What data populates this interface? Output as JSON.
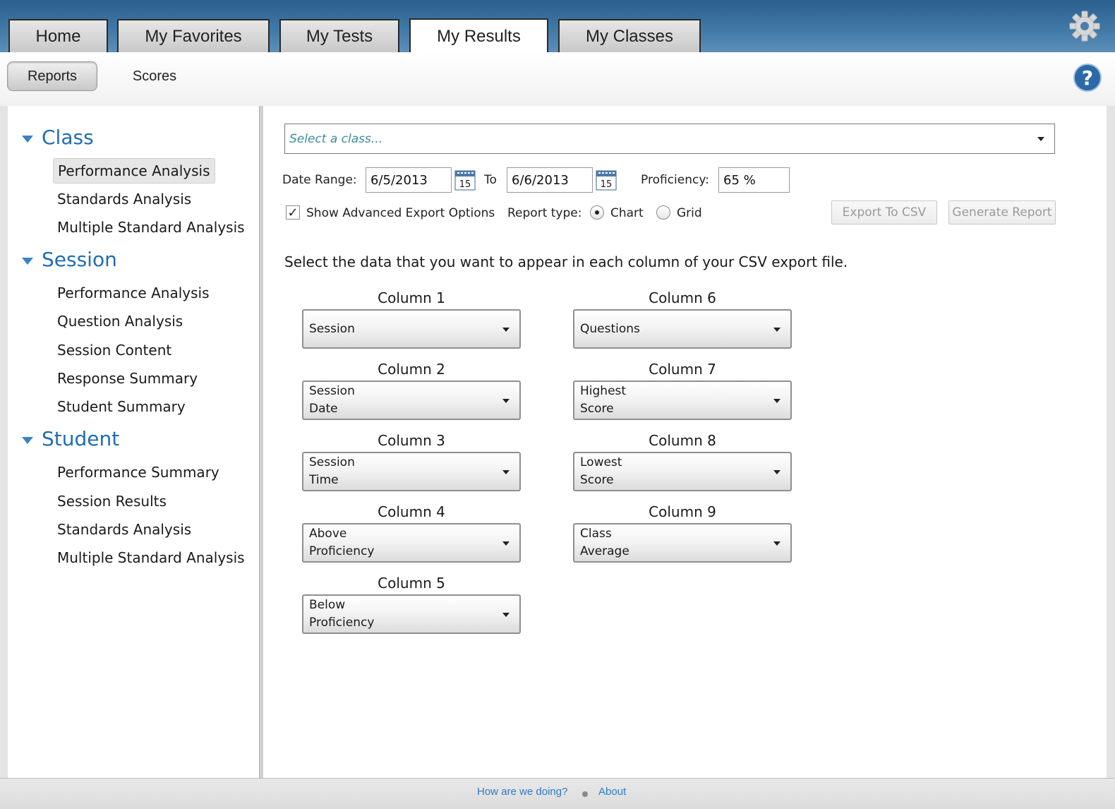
{
  "tabs": [
    {
      "label": "Home"
    },
    {
      "label": "My Favorites"
    },
    {
      "label": "My Tests"
    },
    {
      "label": "My Results"
    },
    {
      "label": "My Classes"
    }
  ],
  "active_tab": "My Results",
  "subnav": {
    "reports": "Reports",
    "scores": "Scores",
    "help": "?"
  },
  "sidebar": {
    "sections": [
      {
        "title": "Class",
        "items": [
          "Performance Analysis",
          "Standards Analysis",
          "Multiple Standard Analysis"
        ]
      },
      {
        "title": "Session",
        "items": [
          "Performance Analysis",
          "Question Analysis",
          "Session Content",
          "Response Summary",
          "Student Summary"
        ]
      },
      {
        "title": "Student",
        "items": [
          "Performance Summary",
          "Session Results",
          "Standards Analysis",
          "Multiple Standard Analysis"
        ]
      }
    ],
    "selected": "Class / Performance Analysis"
  },
  "main": {
    "class_select_placeholder": "Select a class...",
    "date_range_label": "Date Range:",
    "date_from": "6/5/2013",
    "to_label": "To",
    "date_to": "6/6/2013",
    "calendar_day": "15",
    "proficiency_label": "Proficiency:",
    "proficiency_value": "65 %",
    "advanced_export_label": "Show Advanced Export Options",
    "advanced_export_checked": true,
    "report_type_label": "Report type:",
    "report_type_chart": "Chart",
    "report_type_grid": "Grid",
    "report_type_selected": "Chart",
    "export_csv_label": "Export To CSV",
    "generate_report_label": "Generate Report",
    "instructions": "Select the data that you want to appear in each column of your CSV export file.",
    "columns": [
      {
        "title": "Column 1",
        "value": "Session"
      },
      {
        "title": "Column 2",
        "value": "Session Date"
      },
      {
        "title": "Column 3",
        "value": "Session Time"
      },
      {
        "title": "Column 4",
        "value": "Above Proficiency"
      },
      {
        "title": "Column 5",
        "value": "Below Proficiency"
      },
      {
        "title": "Column 6",
        "value": "Questions"
      },
      {
        "title": "Column 7",
        "value": "Highest Score"
      },
      {
        "title": "Column 8",
        "value": "Lowest Score"
      },
      {
        "title": "Column 9",
        "value": "Class Average"
      }
    ]
  },
  "footer": {
    "feedback": "How are we doing?",
    "about": "About"
  },
  "icons": {
    "settings": "gear-icon",
    "help": "help-icon",
    "calendar": "calendar-icon",
    "dropdown": "chevron-down-icon"
  },
  "colors": {
    "accent": "#1f6db3",
    "tabbar": "#3f78a6",
    "link": "#2f7cc4"
  }
}
